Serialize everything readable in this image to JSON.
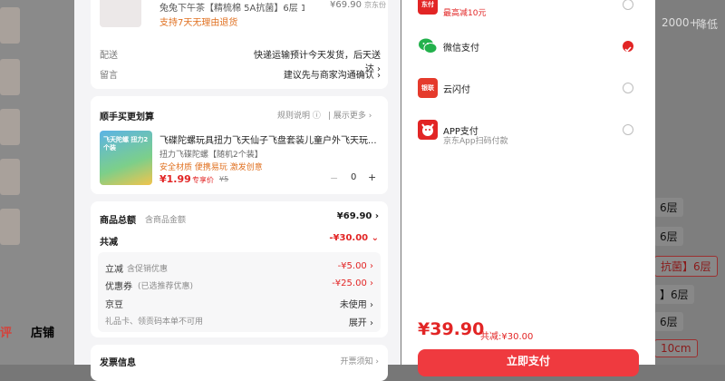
{
  "product": {
    "title": "兔兔下午茶【精梳棉 5A抗菌】6层 1...",
    "price": "¥69.90",
    "shop": "京东份",
    "tag": "支持7天无理由退货"
  },
  "delivery": {
    "label": "配送",
    "value": "快递运输预计今天发货，后天送达"
  },
  "message": {
    "label": "留言",
    "value": "建议先与商家沟通确认"
  },
  "bundle": {
    "title": "顺手买更划算",
    "rules": "规则说明",
    "more": "展示更多",
    "item_title": "飞碟陀螺玩具扭力飞天仙子飞盘套装儿童户外飞天玩...",
    "item_spec": "扭力飞碟陀螺【随机2个装】",
    "item_tags": "安全材质 便携易玩 激发创意",
    "item_price": "¥1.99",
    "item_price_label": "专享价",
    "item_orig": "¥5",
    "qty": "0",
    "minus": "−",
    "plus": "+",
    "img_text": "飞天陀螺 扭力2个装"
  },
  "summary": {
    "total_label": "商品总额",
    "total_sub": "含商品金额",
    "total_value": "¥69.90",
    "reduce_label": "共减",
    "reduce_value": "-¥30.00",
    "instant_label": "立减",
    "instant_sub": "含促销优惠",
    "instant_value": "-¥5.00",
    "coupon_label": "优惠券",
    "coupon_sub": "(已选推荐优惠)",
    "coupon_value": "-¥25.00",
    "jd_label": "京豆",
    "jd_value": "未使用",
    "gift_label": "礼品卡、领贡码本单不可用",
    "gift_value": "展开"
  },
  "invoice": {
    "label": "发票信息",
    "value": "开票须知"
  },
  "payment": {
    "methods": [
      {
        "name": "",
        "sub": "最高减10元",
        "icon_text": "东付",
        "icon": "jd-pay-icon",
        "selected": false
      },
      {
        "name": "微信支付",
        "sub": "",
        "icon_text": "",
        "icon": "wechat-pay-icon",
        "selected": true
      },
      {
        "name": "云闪付",
        "sub": "",
        "icon_text": "银联",
        "icon": "unionpay-icon",
        "selected": false
      },
      {
        "name": "APP支付",
        "sub": "京东App扫码付款",
        "icon_text": "",
        "icon": "jd-app-icon",
        "selected": false
      }
    ],
    "total": "¥39.90",
    "total_reduce": "共减:¥30.00",
    "submit": "立即支付"
  },
  "background": {
    "tab_left": "评",
    "tab_shop": "店铺",
    "top_count": "2000+",
    "top_more": "降低",
    "chips": [
      "6层",
      "6层",
      "抗菌】6层",
      "】6层",
      "6层",
      "6层",
      "10cm"
    ]
  }
}
